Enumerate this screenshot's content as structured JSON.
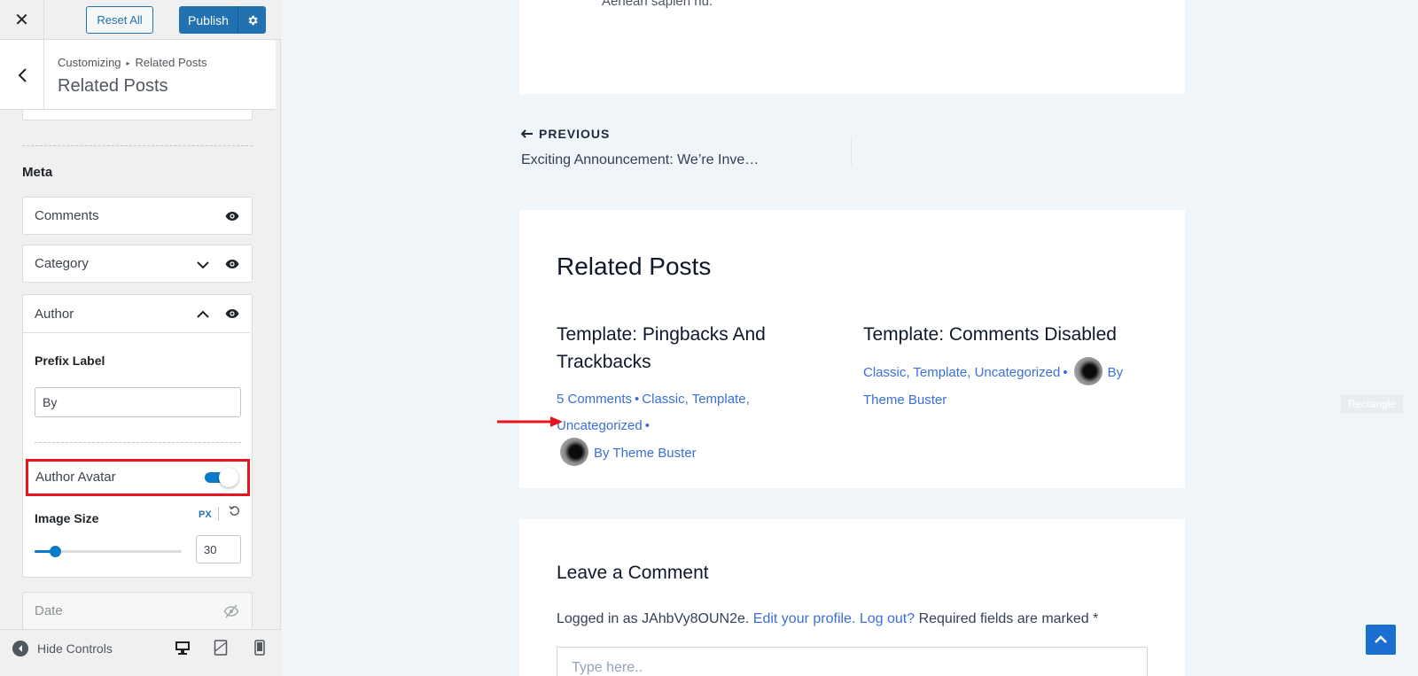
{
  "topbar": {
    "reset_label": "Reset All",
    "publish_label": "Publish"
  },
  "section": {
    "breadcrumb_parent": "Customizing",
    "breadcrumb_current": "Related Posts",
    "title": "Related Posts"
  },
  "meta": {
    "heading": "Meta",
    "items": [
      {
        "label": "Comments",
        "visible": true
      },
      {
        "label": "Category",
        "visible": true
      },
      {
        "label": "Author",
        "visible": true,
        "expanded": true
      },
      {
        "label": "Date",
        "visible": false
      }
    ],
    "author": {
      "prefix_label": "Prefix Label",
      "prefix_value": "By",
      "avatar_label": "Author Avatar",
      "avatar_enabled": true,
      "image_size_label": "Image Size",
      "image_size_unit": "PX",
      "image_size_value": "30",
      "slider_fraction": 0.14
    }
  },
  "footer": {
    "hide_controls": "Hide Controls"
  },
  "preview": {
    "post_end_text": "Aenean sapien nu.",
    "nav": {
      "prev_label": "PREVIOUS",
      "prev_title": "Exciting Announcement: We’re Inve…"
    },
    "related_title": "Related Posts",
    "posts": [
      {
        "title_line1": "Template: Pingbacks And",
        "title_line2": "Trackbacks",
        "comments": "5 Comments",
        "categories": "Classic, Template, Uncategorized",
        "author": "By Theme Buster"
      },
      {
        "title_line1": "Template: Comments Disabled",
        "categories": "Classic, Template, Uncategorized",
        "by": "By",
        "author": "Theme Buster"
      }
    ],
    "comment": {
      "title": "Leave a Comment",
      "logged_prefix": "Logged in as JAhbVy8OUN2e.",
      "edit_profile": "Edit your profile.",
      "logout": "Log out?",
      "required": "Required fields are marked *",
      "placeholder": "Type here.."
    },
    "rect_tag": "Rectangle"
  },
  "colors": {
    "accent": "#2271b1",
    "toggle": "#0b7ac8",
    "link": "#3a6fd8",
    "highlight": "#e8141d"
  }
}
